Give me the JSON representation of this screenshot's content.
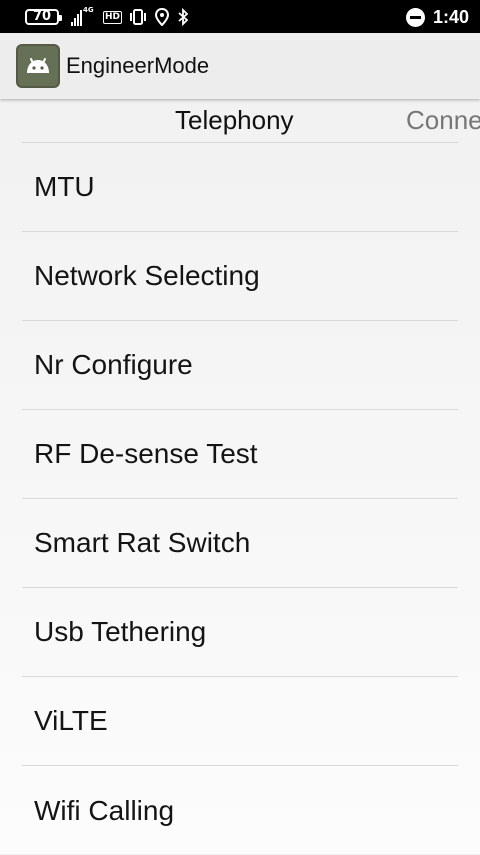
{
  "status_bar": {
    "battery_level": "70",
    "network_type": "4G",
    "hd_label": "HD",
    "time": "1:40",
    "icons": [
      "signal-icon",
      "hd-icon",
      "vibrate-icon",
      "location-icon",
      "bluetooth-icon",
      "do-not-disturb-icon"
    ]
  },
  "app_bar": {
    "title": "EngineerMode",
    "icon": "android-icon"
  },
  "tabs": [
    {
      "label": "Telephony",
      "selected": true
    },
    {
      "label": "Conne",
      "selected": false
    }
  ],
  "list": {
    "items": [
      {
        "label": "MTU"
      },
      {
        "label": "Network Selecting"
      },
      {
        "label": "Nr Configure"
      },
      {
        "label": "RF De-sense Test"
      },
      {
        "label": "Smart Rat Switch"
      },
      {
        "label": "Usb Tethering"
      },
      {
        "label": "ViLTE"
      },
      {
        "label": "Wifi Calling"
      }
    ]
  }
}
